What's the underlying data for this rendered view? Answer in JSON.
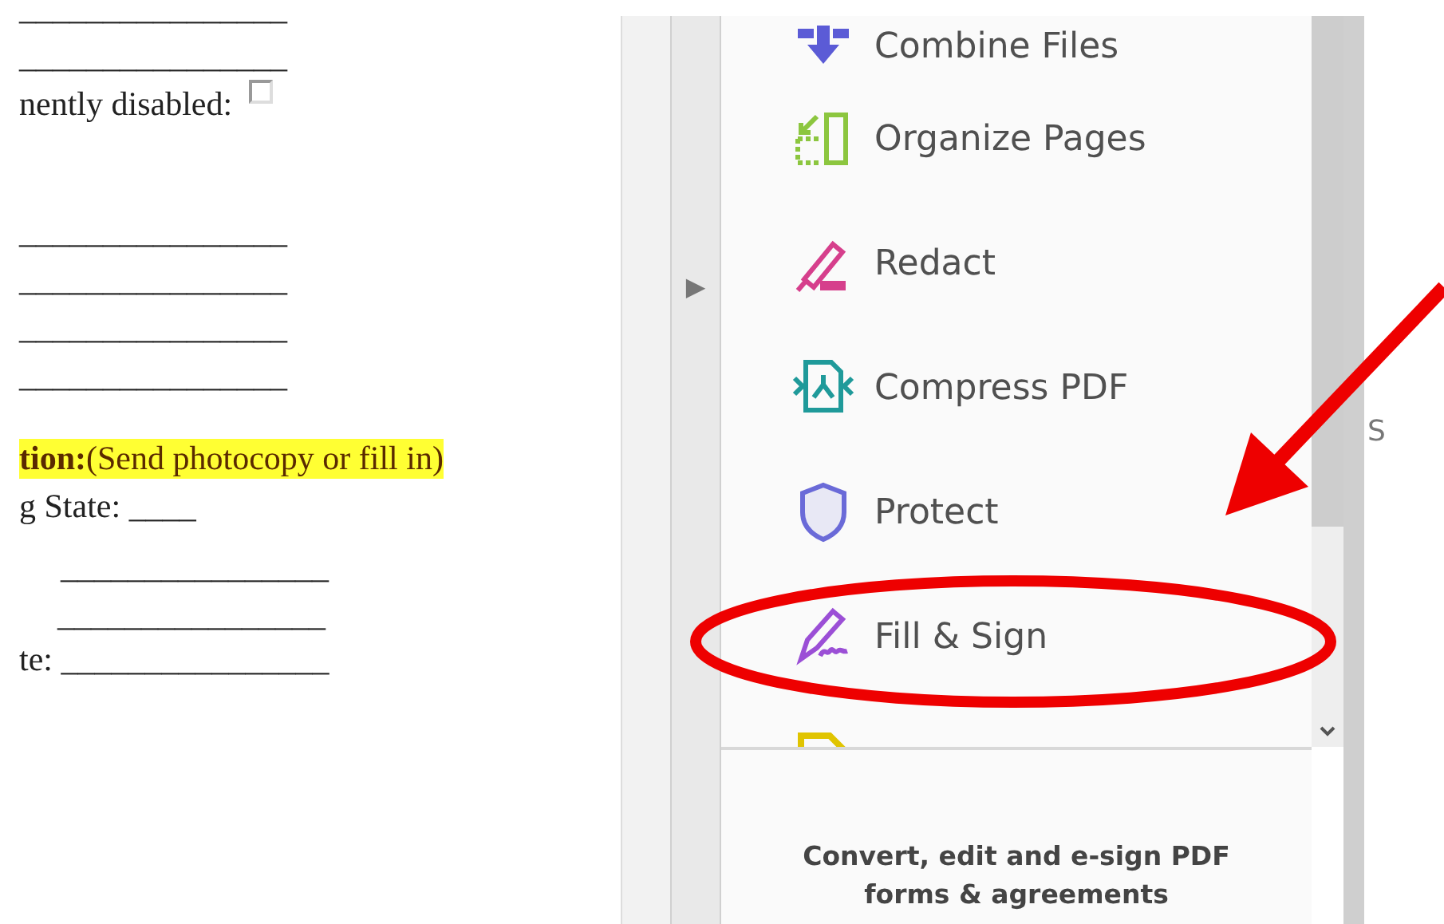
{
  "document": {
    "lines": [
      {
        "kind": "blank",
        "text": "________________"
      },
      {
        "kind": "blank",
        "text": "________________"
      },
      {
        "kind": "checkbox",
        "text": "nently disabled:",
        "checked": false
      },
      {
        "kind": "blank",
        "text": "________________"
      },
      {
        "kind": "blank",
        "text": "________________"
      },
      {
        "kind": "blank",
        "text": "________________"
      },
      {
        "kind": "blank",
        "text": "________________"
      },
      {
        "kind": "highlight",
        "bold": "tion:",
        "text": "(Send photocopy or fill in)"
      },
      {
        "kind": "text",
        "text": "g State: ____"
      },
      {
        "kind": "blank",
        "text": "________________"
      },
      {
        "kind": "blank",
        "text": "________________"
      },
      {
        "kind": "text",
        "text": "te: ________________"
      }
    ]
  },
  "collapse_arrow": "▶",
  "tools": {
    "items": [
      {
        "kind": "combine",
        "label": "Combine Files"
      },
      {
        "kind": "organize",
        "label": "Organize Pages"
      },
      {
        "kind": "redact",
        "label": "Redact"
      },
      {
        "kind": "compress",
        "label": "Compress PDF"
      },
      {
        "kind": "protect",
        "label": "Protect"
      },
      {
        "kind": "fillsign",
        "label": "Fill & Sign"
      },
      {
        "kind": "send"
      }
    ],
    "promo": "Convert, edit and e-sign PDF forms & agreements"
  },
  "side_text": "S"
}
